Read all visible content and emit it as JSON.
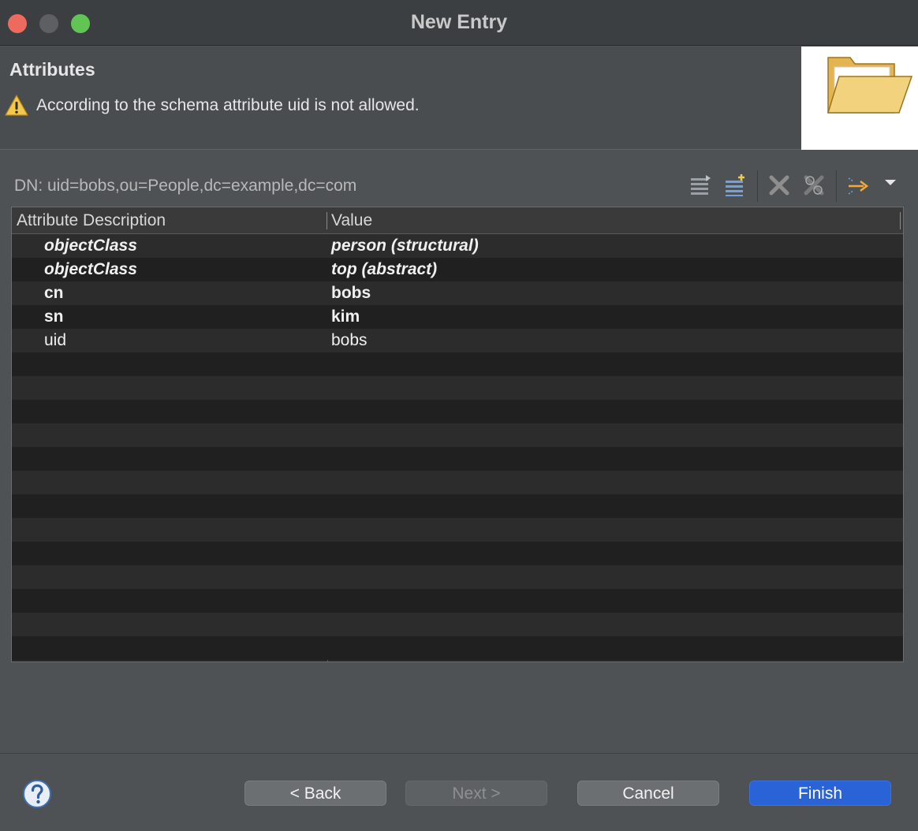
{
  "window": {
    "title": "New Entry"
  },
  "header": {
    "title": "Attributes",
    "warning": "According to the schema attribute uid is not allowed.",
    "banner_icon": "open-folder-icon"
  },
  "dn": {
    "label": "DN: uid=bobs,ou=People,dc=example,dc=com"
  },
  "toolbar": {
    "icons": [
      "new-value-icon",
      "new-attribute-icon",
      "delete-icon",
      "delete-all-icon",
      "move-icon",
      "view-menu-icon"
    ]
  },
  "table": {
    "columns": [
      "Attribute Description",
      "Value"
    ],
    "rows": [
      {
        "attribute": "objectClass",
        "value": "person (structural)",
        "style": "bold-italic"
      },
      {
        "attribute": "objectClass",
        "value": "top (abstract)",
        "style": "bold-italic"
      },
      {
        "attribute": "cn",
        "value": "bobs",
        "style": "bold"
      },
      {
        "attribute": "sn",
        "value": "kim",
        "style": "bold"
      },
      {
        "attribute": "uid",
        "value": "bobs",
        "style": "normal"
      }
    ],
    "empty_rows": 13
  },
  "footer": {
    "back": "< Back",
    "next": "Next >",
    "cancel": "Cancel",
    "finish": "Finish"
  },
  "colors": {
    "accent": "#2a63d6",
    "warning": "#f2c94c",
    "close": "#ed6a5e",
    "maximize": "#61c554"
  }
}
